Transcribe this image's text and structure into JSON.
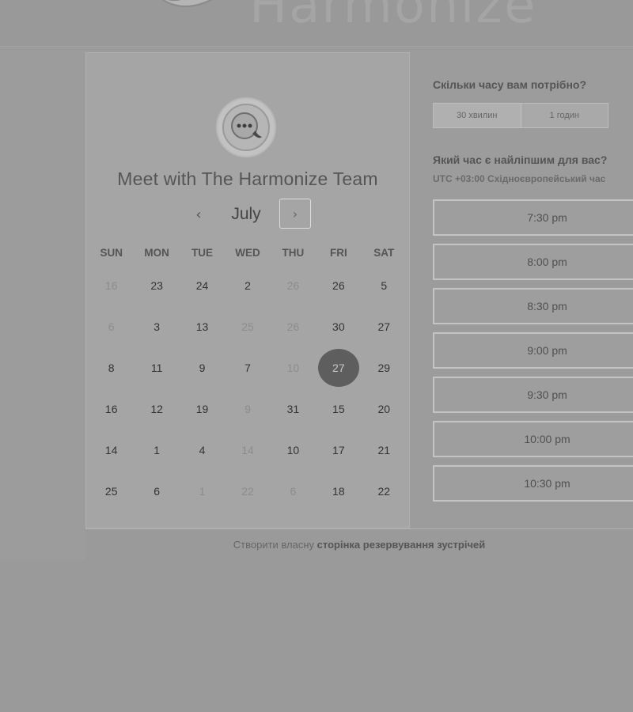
{
  "header": {
    "logo_text": "Harmonize"
  },
  "calendar": {
    "title": "Meet with The Harmonize Team",
    "month": "July",
    "prev_glyph": "‹",
    "next_glyph": "›",
    "days_of_week": [
      "SUN",
      "MON",
      "TUE",
      "WED",
      "THU",
      "FRI",
      "SAT"
    ],
    "weeks": [
      [
        {
          "d": "16",
          "muted": true
        },
        {
          "d": "23"
        },
        {
          "d": "24"
        },
        {
          "d": "2"
        },
        {
          "d": "26",
          "muted": true
        },
        {
          "d": "26"
        },
        {
          "d": "5"
        }
      ],
      [
        {
          "d": "6",
          "muted": true
        },
        {
          "d": "3"
        },
        {
          "d": "13"
        },
        {
          "d": "25",
          "muted": true
        },
        {
          "d": "26",
          "muted": true
        },
        {
          "d": "30"
        },
        {
          "d": "27"
        }
      ],
      [
        {
          "d": "8"
        },
        {
          "d": "11"
        },
        {
          "d": "9"
        },
        {
          "d": "7"
        },
        {
          "d": "10",
          "muted": true
        },
        {
          "d": "27",
          "selected": true
        },
        {
          "d": "29"
        }
      ],
      [
        {
          "d": "16"
        },
        {
          "d": "12"
        },
        {
          "d": "19"
        },
        {
          "d": "9",
          "muted": true
        },
        {
          "d": "31"
        },
        {
          "d": "15"
        },
        {
          "d": "20"
        }
      ],
      [
        {
          "d": "14"
        },
        {
          "d": "1"
        },
        {
          "d": "4"
        },
        {
          "d": "14",
          "muted": true
        },
        {
          "d": "10"
        },
        {
          "d": "17"
        },
        {
          "d": "21"
        }
      ],
      [
        {
          "d": "25"
        },
        {
          "d": "6"
        },
        {
          "d": "1",
          "muted": true
        },
        {
          "d": "22",
          "muted": true
        },
        {
          "d": "6",
          "muted": true
        },
        {
          "d": "18"
        },
        {
          "d": "22"
        }
      ]
    ],
    "selected_color": "#5e5e5e"
  },
  "booking": {
    "duration_question": "Скільки часу вам потрібно?",
    "durations": [
      "30 хвилин",
      "1 годин"
    ],
    "time_question": "Який час є найліпшим для вас?",
    "timezone": "UTC +03:00 Східноєвропейський час",
    "slots": [
      "7:30 pm",
      "8:00 pm",
      "8:30 pm",
      "9:00 pm",
      "9:30 pm",
      "10:00 pm",
      "10:30 pm"
    ]
  },
  "footer": {
    "prefix": "Створити власну",
    "link": "сторінка резервування зустрічей"
  }
}
